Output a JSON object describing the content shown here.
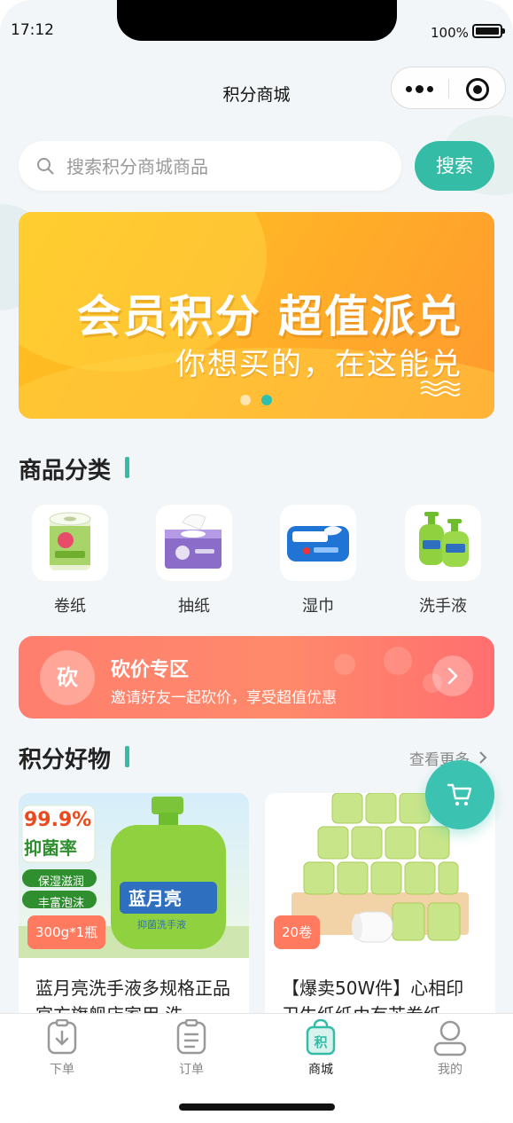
{
  "status_bar": {
    "time": "17:12",
    "battery": "100%"
  },
  "nav": {
    "title": "积分商城"
  },
  "search": {
    "placeholder": "搜索积分商城商品",
    "button_label": "搜索"
  },
  "banner": {
    "title": "会员积分 超值派兑",
    "subtitle": "你想买的，在这能兑",
    "pages": 2,
    "active_page": 2
  },
  "categories": {
    "title": "商品分类",
    "items": [
      {
        "label": "卷纸",
        "icon": "toilet-roll-icon"
      },
      {
        "label": "抽纸",
        "icon": "tissue-box-icon"
      },
      {
        "label": "湿巾",
        "icon": "wet-wipes-icon"
      },
      {
        "label": "洗手液",
        "icon": "hand-soap-icon"
      }
    ]
  },
  "bargain": {
    "badge": "砍",
    "title": "砍价专区",
    "subtitle": "邀请好友一起砍价，享受超值优惠"
  },
  "goods": {
    "title": "积分好物",
    "more_label": "查看更多",
    "items": [
      {
        "tag": "300g*1瓶",
        "name": "蓝月亮洗手液多规格正品官方旗舰店家用 洗",
        "img_text": {
          "badge_top": "99.9%",
          "badge_bottom": "抑菌率",
          "feature1": "保湿滋润",
          "feature2": "丰富泡沫",
          "brand": "蓝月亮",
          "product": "抑菌洗手液"
        }
      },
      {
        "tag": "20卷",
        "name": "【爆卖50W件】心相印卫生纸纸巾有芯卷纸"
      }
    ]
  },
  "tabbar": {
    "items": [
      {
        "label": "下单",
        "icon": "download-icon",
        "active": false
      },
      {
        "label": "订单",
        "icon": "clipboard-icon",
        "active": false
      },
      {
        "label": "商城",
        "icon": "points-bag-icon",
        "active": true,
        "glyph": "积"
      },
      {
        "label": "我的",
        "icon": "user-icon",
        "active": false
      }
    ]
  },
  "colors": {
    "accent": "#35bca6",
    "banner": "#ffb327",
    "bargain": "#ff7e6e",
    "tag": "#ff7a5e"
  }
}
